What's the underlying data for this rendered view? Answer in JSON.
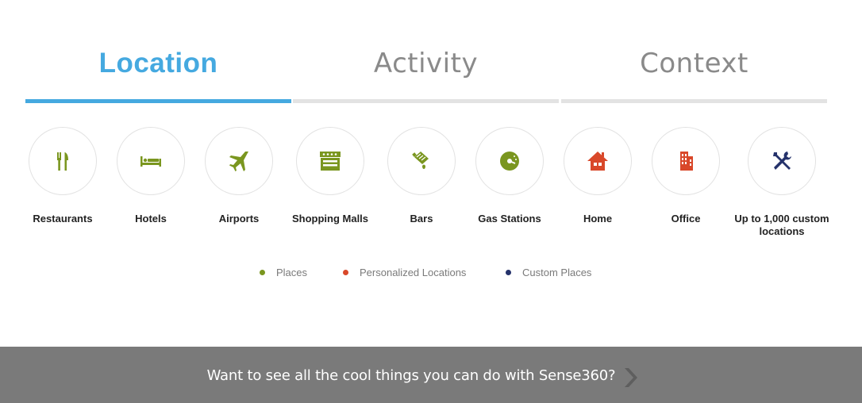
{
  "tabs": [
    {
      "label": "Location",
      "active": true
    },
    {
      "label": "Activity",
      "active": false
    },
    {
      "label": "Context",
      "active": false
    }
  ],
  "categories": [
    {
      "label": "Restaurants",
      "icon": "fork-knife-icon",
      "color": "#7a961f"
    },
    {
      "label": "Hotels",
      "icon": "bed-icon",
      "color": "#7a961f"
    },
    {
      "label": "Airports",
      "icon": "airplane-icon",
      "color": "#7a961f"
    },
    {
      "label": "Shopping Malls",
      "icon": "storefront-icon",
      "color": "#7a961f"
    },
    {
      "label": "Bars",
      "icon": "cocktail-icon",
      "color": "#7a961f"
    },
    {
      "label": "Gas Stations",
      "icon": "gauge-icon",
      "color": "#7a961f"
    },
    {
      "label": "Home",
      "icon": "house-icon",
      "color": "#d9482a"
    },
    {
      "label": "Office",
      "icon": "building-icon",
      "color": "#d9482a"
    },
    {
      "label": "Up to 1,000 custom locations",
      "icon": "wrench-screwdriver-icon",
      "color": "#25326b"
    }
  ],
  "legend": [
    {
      "label": "Places",
      "color": "#7a961f"
    },
    {
      "label": "Personalized Locations",
      "color": "#d9482a"
    },
    {
      "label": "Custom Places",
      "color": "#25326b"
    }
  ],
  "cta": {
    "text": "Want to see all the cool things you can do with Sense360?",
    "icon": "chevron-right-icon"
  },
  "colors": {
    "accent": "#45a9e0",
    "inactive_tab": "#8a8a8a",
    "cta_bg": "#7a7a7a"
  }
}
